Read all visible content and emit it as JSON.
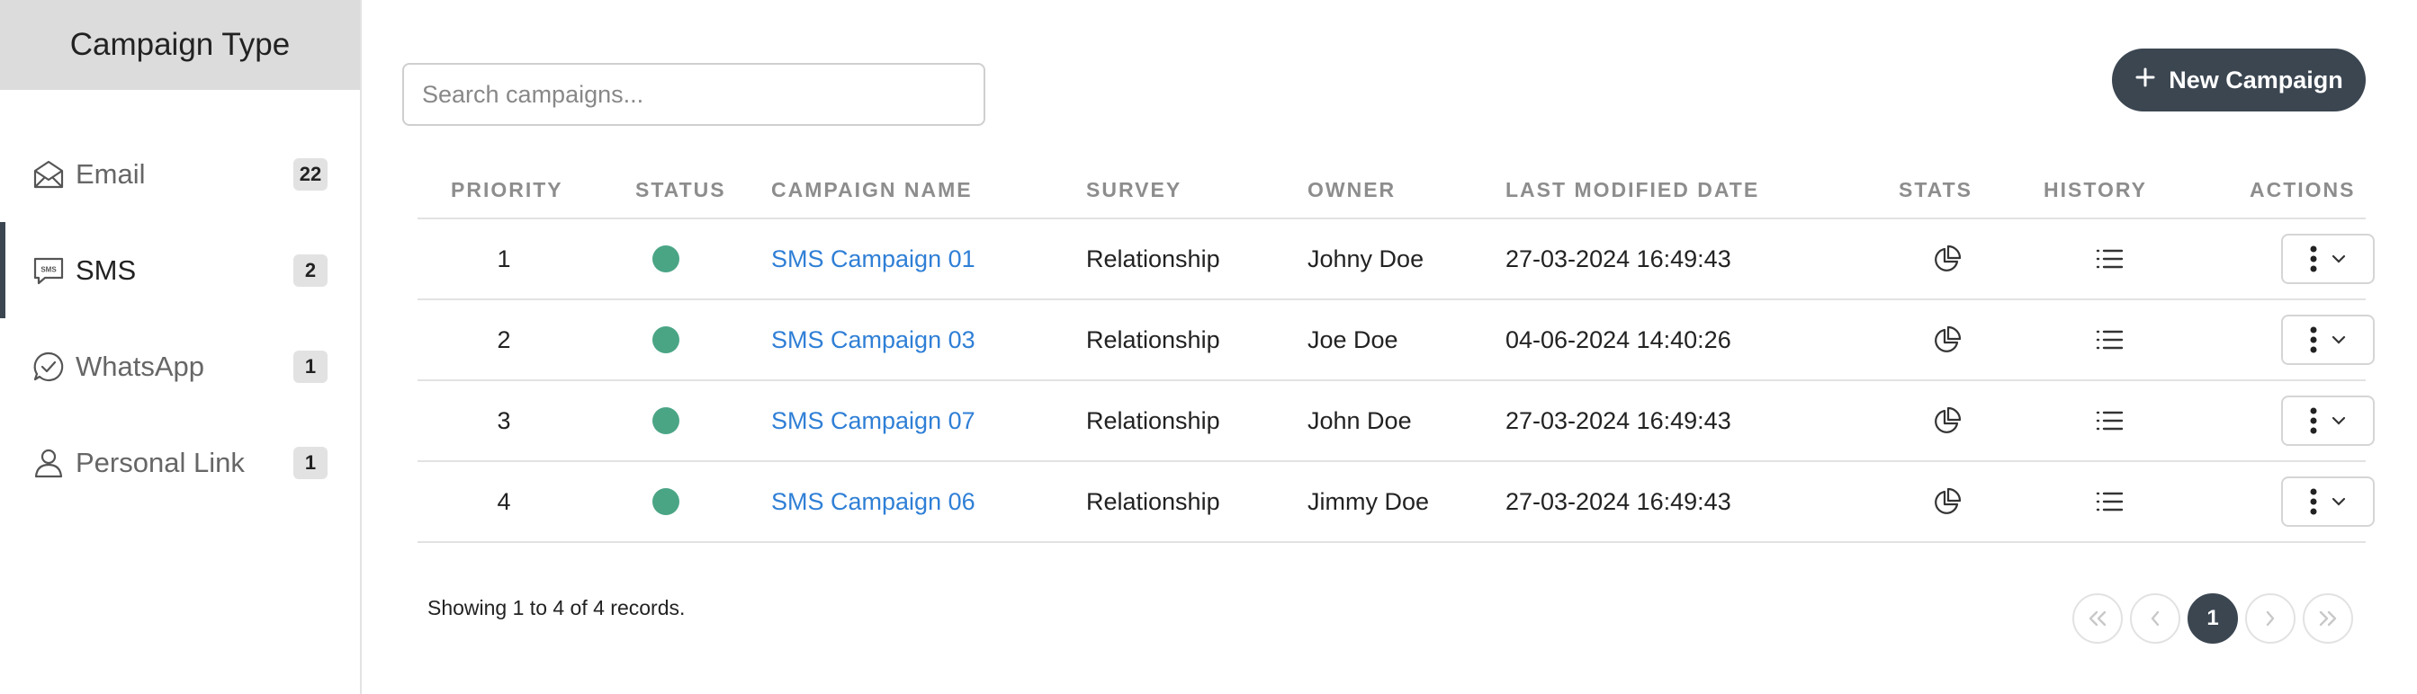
{
  "sidebar": {
    "title": "Campaign Type",
    "items": [
      {
        "label": "Email",
        "count": "22",
        "icon": "email-icon",
        "active": false
      },
      {
        "label": "SMS",
        "count": "2",
        "icon": "sms-icon",
        "active": true
      },
      {
        "label": "WhatsApp",
        "count": "1",
        "icon": "whatsapp-icon",
        "active": false
      },
      {
        "label": "Personal Link",
        "count": "1",
        "icon": "user-icon",
        "active": false
      }
    ]
  },
  "search": {
    "placeholder": "Search campaigns...",
    "value": ""
  },
  "new_campaign_label": "New Campaign",
  "table": {
    "headers": {
      "priority": "PRIORITY",
      "status": "STATUS",
      "name": "CAMPAIGN NAME",
      "survey": "SURVEY",
      "owner": "OWNER",
      "modified": "LAST MODIFIED DATE",
      "stats": "STATS",
      "history": "HISTORY",
      "actions": "ACTIONS"
    },
    "rows": [
      {
        "priority": "1",
        "status": "active",
        "name": "SMS Campaign 01",
        "survey": "Relationship",
        "owner": "Johny Doe",
        "modified": "27-03-2024 16:49:43"
      },
      {
        "priority": "2",
        "status": "active",
        "name": "SMS Campaign 03",
        "survey": "Relationship",
        "owner": "Joe Doe",
        "modified": "04-06-2024 14:40:26"
      },
      {
        "priority": "3",
        "status": "active",
        "name": "SMS Campaign 07",
        "survey": "Relationship",
        "owner": "John Doe",
        "modified": "27-03-2024 16:49:43"
      },
      {
        "priority": "4",
        "status": "active",
        "name": "SMS Campaign 06",
        "survey": "Relationship",
        "owner": "Jimmy Doe",
        "modified": "27-03-2024 16:49:43"
      }
    ]
  },
  "footer": {
    "records_text": "Showing 1 to 4 of 4 records."
  },
  "pagination": {
    "current_page": "1"
  },
  "colors": {
    "accent": "#3b4651",
    "link": "#2f7fd6",
    "status_active": "#4aa585"
  }
}
